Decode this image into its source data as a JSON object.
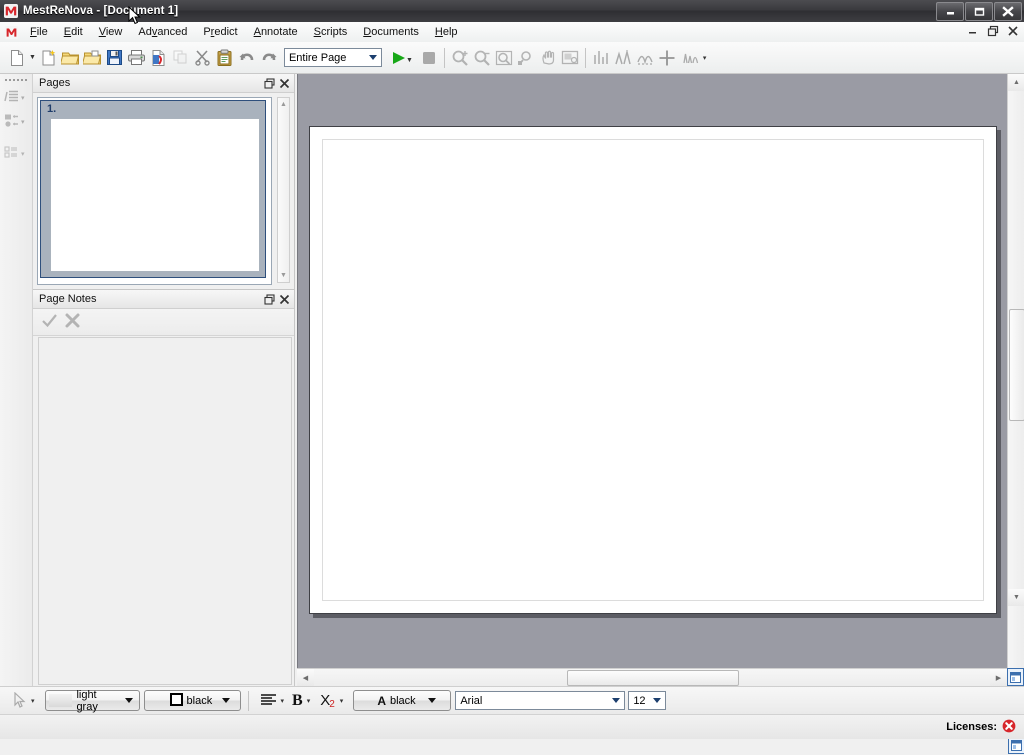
{
  "window": {
    "title": "MestReNova - [Document 1]",
    "logo_icon": "mestrenova-logo-icon",
    "controls": [
      {
        "name": "minimize-button",
        "glyph": "—"
      },
      {
        "name": "restore-button",
        "glyph": "❐"
      },
      {
        "name": "close-button",
        "glyph": "✕"
      }
    ]
  },
  "menubar": {
    "logo_icon": "mestrenova-menu-logo-icon",
    "items": [
      {
        "label": "File",
        "accel": "F"
      },
      {
        "label": "Edit",
        "accel": "E"
      },
      {
        "label": "View",
        "accel": "V"
      },
      {
        "label": "Advanced",
        "accel": "v"
      },
      {
        "label": "Predict",
        "accel": "r"
      },
      {
        "label": "Annotate",
        "accel": "A"
      },
      {
        "label": "Scripts",
        "accel": "S"
      },
      {
        "label": "Documents",
        "accel": "D"
      },
      {
        "label": "Help",
        "accel": "H"
      }
    ],
    "mdi_controls": [
      {
        "name": "mdi-minimize-button",
        "glyph": "–"
      },
      {
        "name": "mdi-restore-button",
        "glyph": "❐"
      },
      {
        "name": "mdi-close-button",
        "glyph": "✕"
      }
    ]
  },
  "toolbar": {
    "zoom_value": "Entire Page",
    "items": [
      {
        "name": "new-document-button",
        "label": "New"
      },
      {
        "name": "new-from-wizard-button",
        "label": "New from Wizard"
      },
      {
        "name": "open-button",
        "label": "Open"
      },
      {
        "name": "open-recent-button",
        "label": "Open Recent"
      },
      {
        "name": "save-button",
        "label": "Save"
      },
      {
        "name": "print-button",
        "label": "Print"
      },
      {
        "name": "export-pdf-button",
        "label": "Export to PDF"
      },
      {
        "name": "copy-button",
        "label": "Copy"
      },
      {
        "name": "cut-button",
        "label": "Cut"
      },
      {
        "name": "paste-button",
        "label": "Paste"
      },
      {
        "name": "undo-button",
        "label": "Undo"
      },
      {
        "name": "redo-button",
        "label": "Redo"
      },
      {
        "name": "run-script-button",
        "label": "Run"
      },
      {
        "name": "stop-button",
        "label": "Stop"
      },
      {
        "name": "zoom-in-button",
        "label": "Zoom In"
      },
      {
        "name": "zoom-out-button",
        "label": "Zoom Out"
      },
      {
        "name": "zoom-region-button",
        "label": "Zoom Region"
      },
      {
        "name": "zoom-reset-button",
        "label": "Reset Zoom"
      },
      {
        "name": "pan-button",
        "label": "Pan"
      },
      {
        "name": "screenshot-button",
        "label": "Screenshot"
      },
      {
        "name": "integral-button",
        "label": "Integration"
      },
      {
        "name": "peak-picking-button",
        "label": "Peak Picking"
      },
      {
        "name": "baseline-button",
        "label": "Baseline"
      },
      {
        "name": "crosshair-button",
        "label": "Crosshair"
      },
      {
        "name": "multiplet-button",
        "label": "Multiplet Analysis"
      }
    ]
  },
  "vertical_strip": {
    "items": [
      {
        "name": "stack-layout-button"
      },
      {
        "name": "page-layout-button"
      },
      {
        "name": "grid-layout-button"
      }
    ]
  },
  "pages_panel": {
    "title": "Pages",
    "float_button": "float-panel-button",
    "close_button": "close-panel-button",
    "thumbnails": [
      {
        "number": "1."
      }
    ]
  },
  "notes_panel": {
    "title": "Page Notes",
    "float_button": "float-panel-button",
    "close_button": "close-panel-button",
    "accept_button": "accept-note-button",
    "reject_button": "reject-note-button",
    "content": ""
  },
  "format_bar": {
    "pointer_tool": "pointer-tool",
    "fill_color": "light gray",
    "line_color": "black",
    "align_tool": "align-left",
    "bold_label": "B",
    "subscript_label": "X",
    "subscript_sub": "2",
    "font_color_glyph": "A",
    "font_color": "black",
    "font_family": "Arial",
    "font_size": "12"
  },
  "statusbar": {
    "licenses_label": "Licenses:",
    "licenses_status_icon": "error-badge-icon"
  },
  "colors": {
    "titlebar": "#3a3a3e",
    "canvas": "#9a9ba4",
    "accent_blue": "#2e4f7c",
    "error_red": "#d7262b",
    "run_green": "#18a818"
  }
}
